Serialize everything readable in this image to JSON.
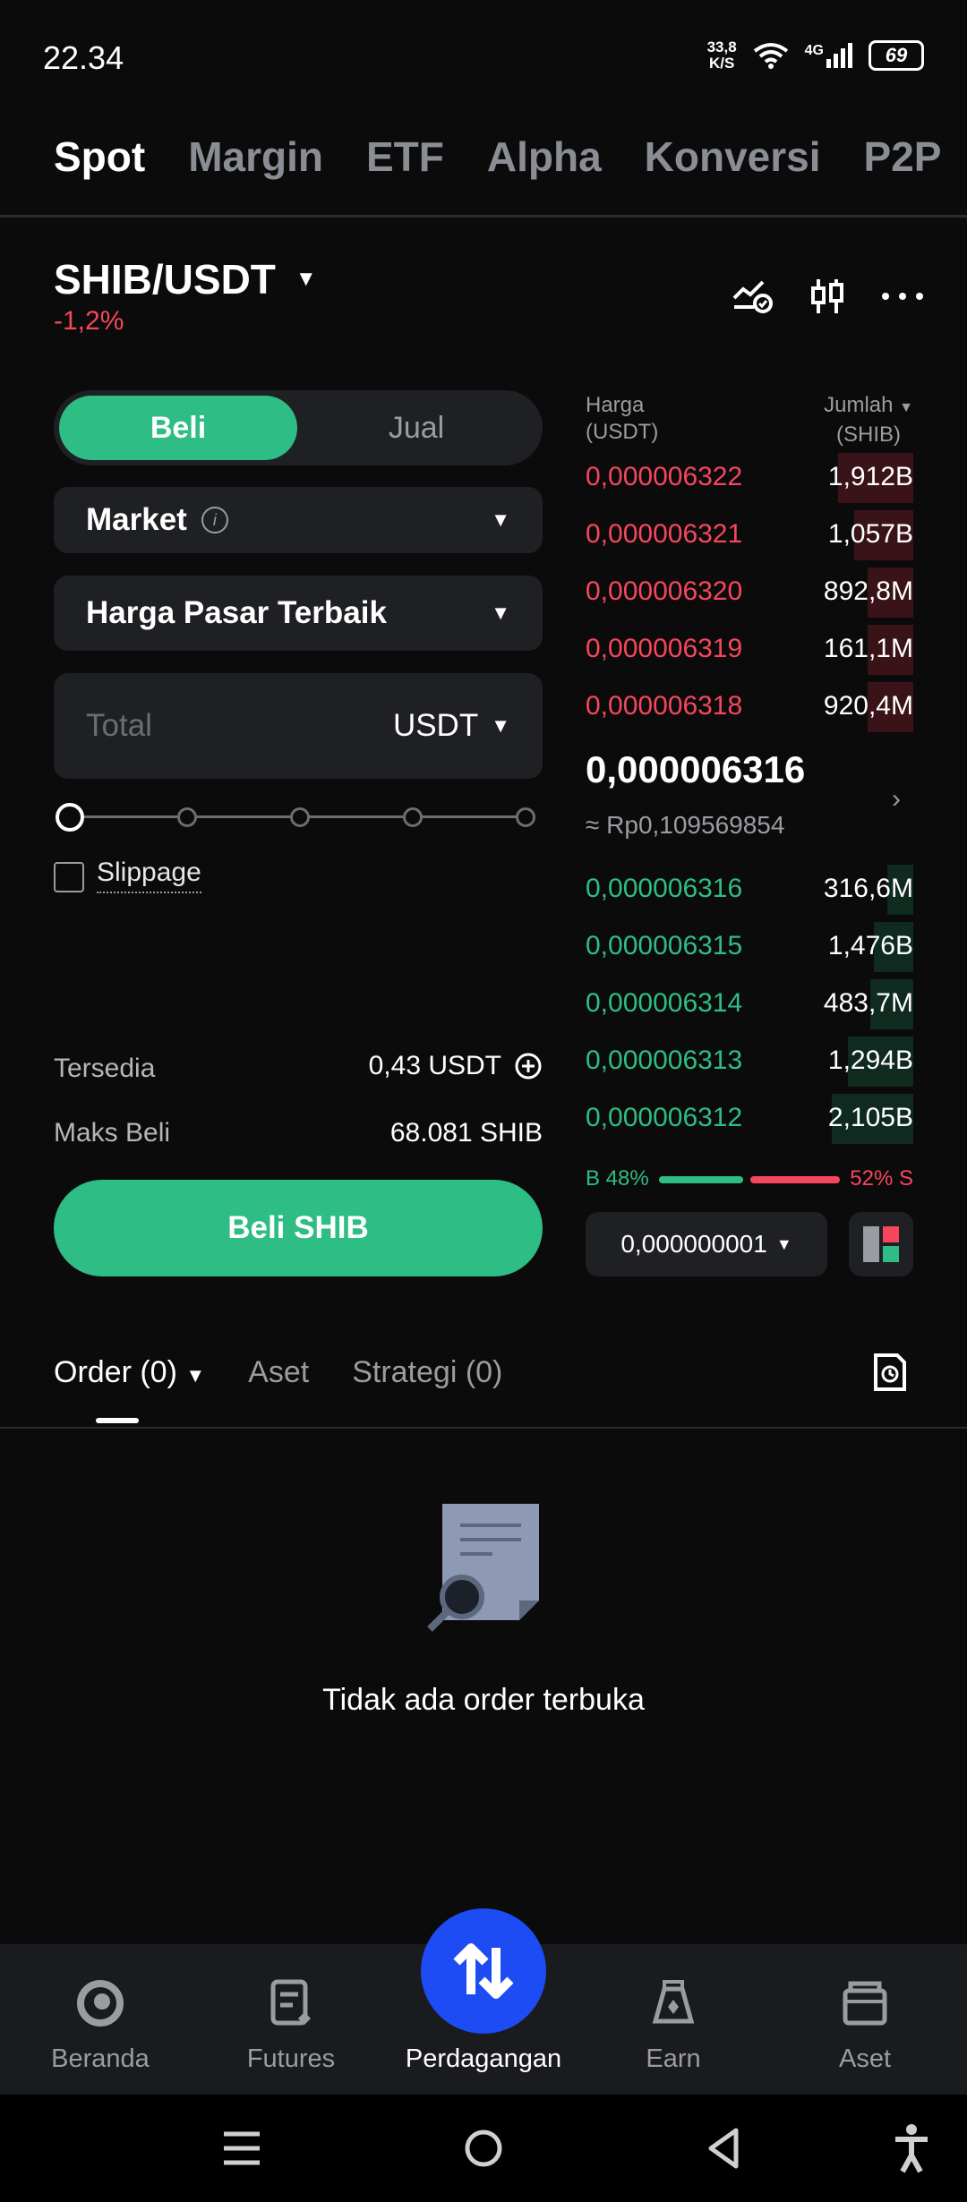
{
  "status": {
    "time": "22.34",
    "net_speed_value": "33,8",
    "net_speed_unit": "K/S",
    "network": "4G",
    "battery": "69"
  },
  "top_tabs": [
    "Spot",
    "Margin",
    "ETF",
    "Alpha",
    "Konversi",
    "P2P"
  ],
  "pair": {
    "name": "SHIB/USDT",
    "change": "-1,2%"
  },
  "form": {
    "buy_label": "Beli",
    "sell_label": "Jual",
    "order_type": "Market",
    "price_mode": "Harga Pasar Terbaik",
    "total_placeholder": "Total",
    "total_currency": "USDT",
    "slider_percent": 0,
    "slippage_label": "Slippage",
    "available_label": "Tersedia",
    "available_value": "0,43 USDT",
    "max_buy_label": "Maks Beli",
    "max_buy_value": "68.081 SHIB",
    "submit_label": "Beli SHIB"
  },
  "order_book": {
    "price_header": "Harga",
    "price_unit": "(USDT)",
    "amount_header": "Jumlah",
    "amount_unit": "(SHIB)",
    "asks": [
      {
        "price": "0,000006322",
        "amount": "1,912B",
        "depth": 0.23
      },
      {
        "price": "0,000006321",
        "amount": "1,057B",
        "depth": 0.18
      },
      {
        "price": "0,000006320",
        "amount": "892,8M",
        "depth": 0.14
      },
      {
        "price": "0,000006319",
        "amount": "161,1M",
        "depth": 0.14
      },
      {
        "price": "0,000006318",
        "amount": "920,4M",
        "depth": 0.14
      }
    ],
    "last_price": "0,000006316",
    "last_price_fiat": "≈ Rp0,109569854",
    "bids": [
      {
        "price": "0,000006316",
        "amount": "316,6M",
        "depth": 0.08
      },
      {
        "price": "0,000006315",
        "amount": "1,476B",
        "depth": 0.12
      },
      {
        "price": "0,000006314",
        "amount": "483,7M",
        "depth": 0.13
      },
      {
        "price": "0,000006313",
        "amount": "1,294B",
        "depth": 0.2
      },
      {
        "price": "0,000006312",
        "amount": "2,105B",
        "depth": 0.25
      }
    ],
    "buy_ratio_label": "B 48%",
    "sell_ratio_label": "52% S",
    "buy_ratio": 0.48,
    "tick_size": "0,000000001"
  },
  "order_tabs": [
    "Order (0)",
    "Aset",
    "Strategi (0)"
  ],
  "empty_message": "Tidak ada order terbuka",
  "nav": [
    "Beranda",
    "Futures",
    "Perdagangan",
    "Earn",
    "Aset"
  ],
  "colors": {
    "green": "#2ebd85",
    "red": "#f6465d",
    "accent_blue": "#1d4cf5"
  }
}
